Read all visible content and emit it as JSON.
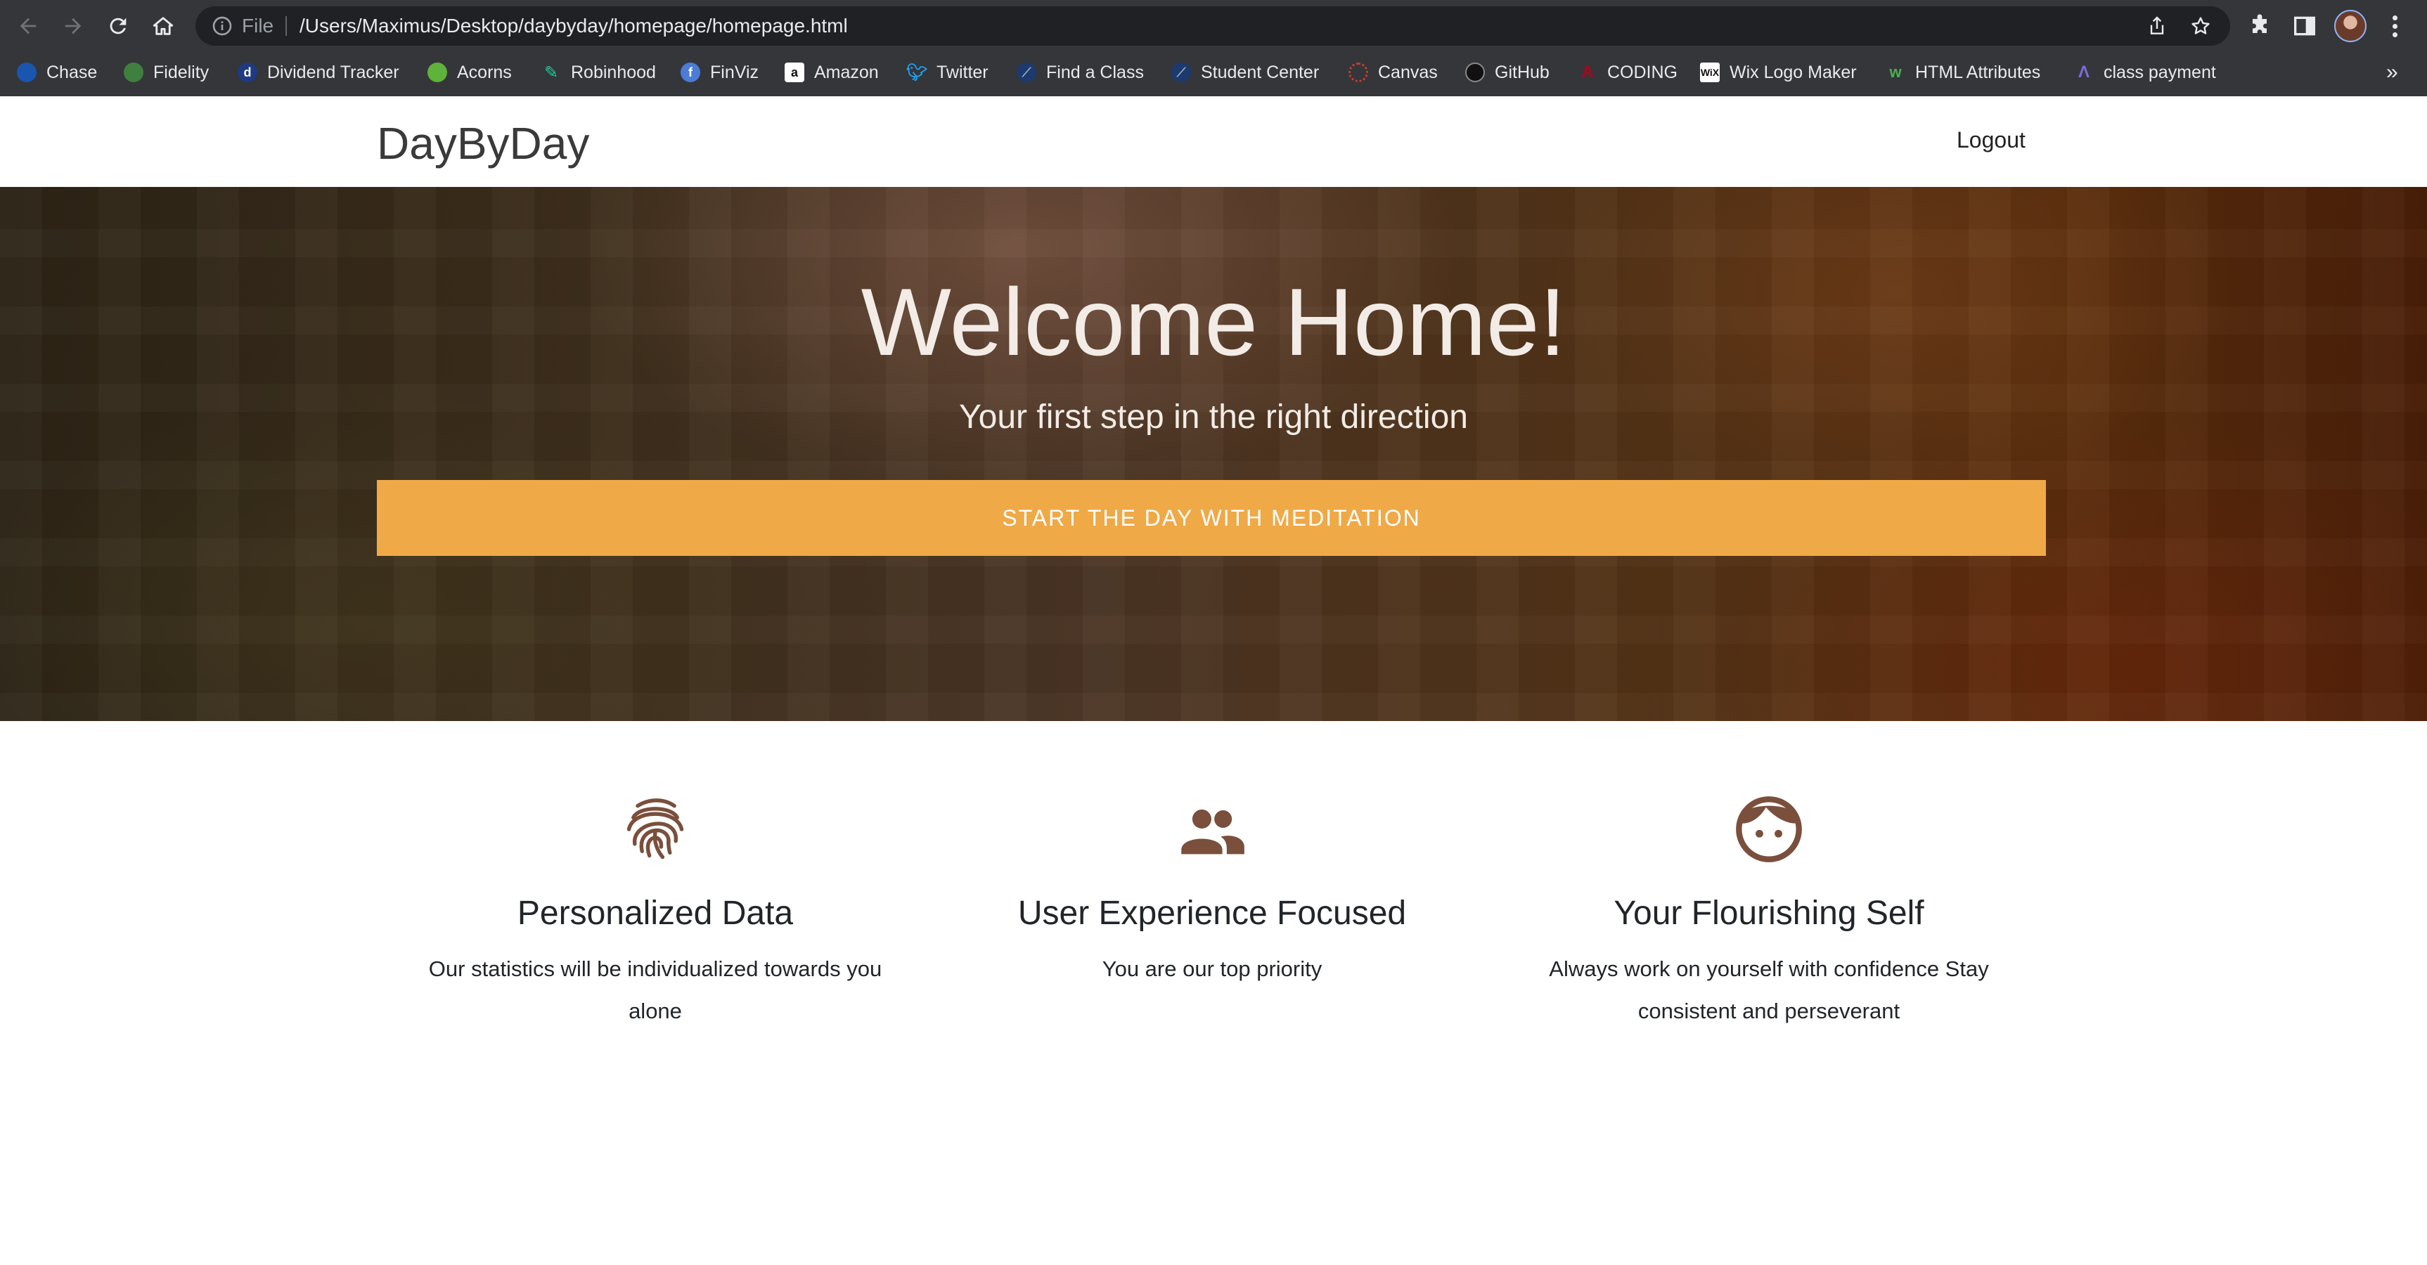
{
  "browser": {
    "omnibox": {
      "scheme_label": "File",
      "url": "/Users/Maximus/Desktop/daybyday/homepage/homepage.html"
    },
    "bookmarks": [
      {
        "label": "Chase",
        "icon": "chase-icon",
        "color": "#1a56b0"
      },
      {
        "label": "Fidelity",
        "icon": "fidelity-icon",
        "color": "#3f7f3f"
      },
      {
        "label": "Dividend Tracker",
        "icon": "dividend-tracker-icon",
        "color": "#1f3a80"
      },
      {
        "label": "Acorns",
        "icon": "acorns-icon",
        "color": "#5fb33a"
      },
      {
        "label": "Robinhood",
        "icon": "robinhood-icon",
        "color": "#21ce99"
      },
      {
        "label": "FinViz",
        "icon": "finviz-icon",
        "color": "#4a7cd8"
      },
      {
        "label": "Amazon",
        "icon": "amazon-icon",
        "color": "#ffffff"
      },
      {
        "label": "Twitter",
        "icon": "twitter-icon",
        "color": "#1da1f2"
      },
      {
        "label": "Find a Class",
        "icon": "find-a-class-icon",
        "color": "#1c3a6e"
      },
      {
        "label": "Student Center",
        "icon": "student-center-icon",
        "color": "#1c3a6e"
      },
      {
        "label": "Canvas",
        "icon": "canvas-icon",
        "color": "#d03a2b"
      },
      {
        "label": "GitHub",
        "icon": "github-icon",
        "color": "#2b2b2b"
      },
      {
        "label": "CODING",
        "icon": "coding-icon",
        "color": "#ab0520"
      },
      {
        "label": "Wix Logo Maker",
        "icon": "wix-icon",
        "color": "#ffffff"
      },
      {
        "label": "HTML Attributes",
        "icon": "html-attributes-icon",
        "color": "#4caf50"
      },
      {
        "label": "class payment",
        "icon": "class-payment-icon",
        "color": "#7b6bd6"
      }
    ],
    "bookmarks_overflow": "»"
  },
  "navbar": {
    "brand": "DayByDay",
    "logout": "Logout"
  },
  "hero": {
    "title": "Welcome Home!",
    "subtitle": "Your first step in the right direction",
    "cta": "START THE DAY WITH MEDITATION",
    "cta_color": "#f0a947"
  },
  "features": [
    {
      "icon": "fingerprint-icon",
      "title": "Personalized Data",
      "text": "Our statistics will be individualized towards you alone"
    },
    {
      "icon": "people-icon",
      "title": "User Experience Focused",
      "text": "You are our top priority"
    },
    {
      "icon": "face-icon",
      "title": "Your Flourishing Self",
      "text": "Always work on yourself with confidence Stay consistent and perseverant"
    }
  ],
  "colors": {
    "icon_brown": "#7a4f3c",
    "chrome_bg": "#35363a"
  }
}
